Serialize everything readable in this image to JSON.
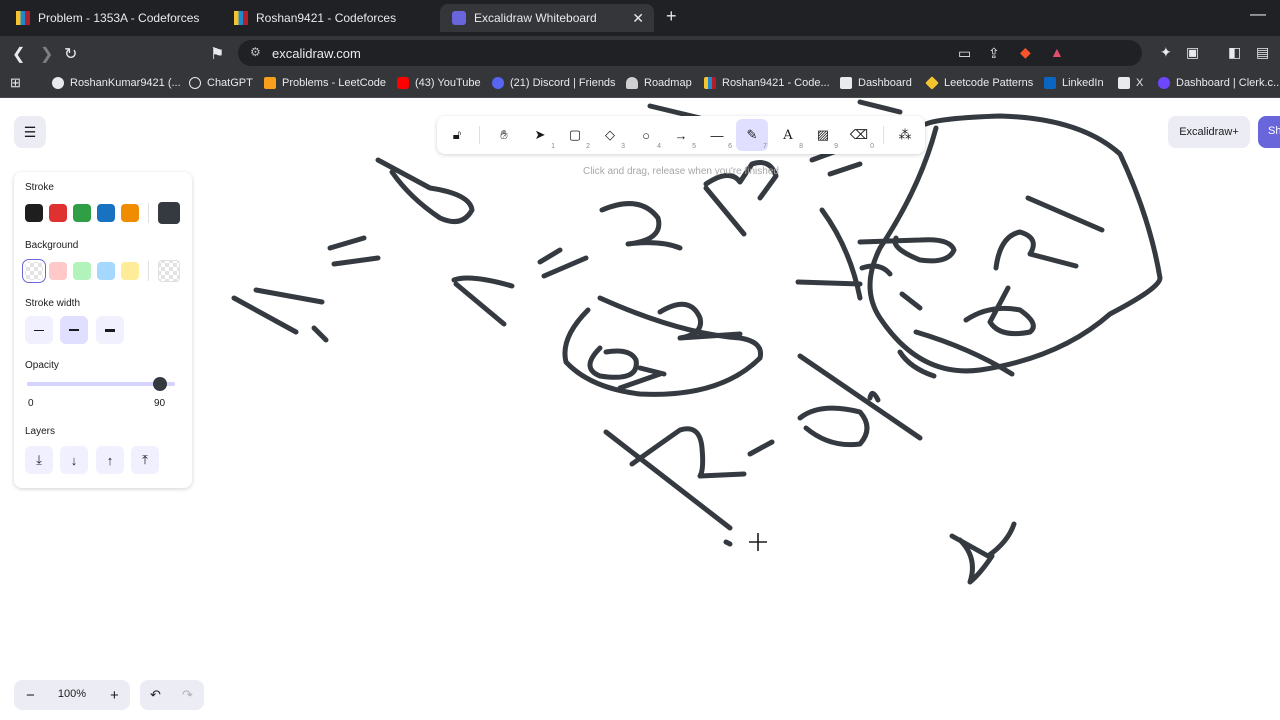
{
  "browser": {
    "tabs": [
      {
        "label": "Problem - 1353A - Codeforces"
      },
      {
        "label": "Roshan9421 - Codeforces"
      },
      {
        "label": "Excalidraw Whiteboard"
      }
    ],
    "url": "excalidraw.com",
    "bookmarks": [
      {
        "label": "RoshanKumar9421 (..."
      },
      {
        "label": "ChatGPT"
      },
      {
        "label": "Problems - LeetCode"
      },
      {
        "label": "(43) YouTube"
      },
      {
        "label": "(21) Discord | Friends"
      },
      {
        "label": "Roadmap"
      },
      {
        "label": "Roshan9421 - Code..."
      },
      {
        "label": "Dashboard"
      },
      {
        "label": "Leetcode Patterns"
      },
      {
        "label": "LinkedIn"
      },
      {
        "label": "X"
      },
      {
        "label": "Dashboard | Clerk.c..."
      }
    ]
  },
  "toolbar": {
    "tools": [
      {
        "name": "lock",
        "num": ""
      },
      {
        "name": "hand",
        "num": ""
      },
      {
        "name": "selection",
        "num": "1"
      },
      {
        "name": "rectangle",
        "num": "2"
      },
      {
        "name": "diamond",
        "num": "3"
      },
      {
        "name": "ellipse",
        "num": "4"
      },
      {
        "name": "arrow",
        "num": "5"
      },
      {
        "name": "line",
        "num": "6"
      },
      {
        "name": "draw",
        "num": "7"
      },
      {
        "name": "text",
        "num": "8"
      },
      {
        "name": "image",
        "num": "9"
      },
      {
        "name": "eraser",
        "num": "0"
      },
      {
        "name": "extra-tools",
        "num": ""
      }
    ],
    "active_tool": "draw",
    "hint": "Click and drag, release when you're finished"
  },
  "top_right": {
    "plus_label": "Excalidraw+",
    "share_label": "Sh"
  },
  "properties": {
    "stroke_label": "Stroke",
    "stroke_colors": [
      "#1e1e1e",
      "#e03131",
      "#2f9e44",
      "#1971c2",
      "#f08c00"
    ],
    "stroke_current": "#343a40",
    "background_label": "Background",
    "background_colors": [
      "transparent",
      "#ffc9c9",
      "#b2f2bb",
      "#a5d8ff",
      "#ffec99"
    ],
    "stroke_width_label": "Stroke width",
    "stroke_width_active": "bold",
    "opacity_label": "Opacity",
    "opacity_min": "0",
    "opacity_max": "90",
    "opacity_value": 0.9,
    "layers_label": "Layers"
  },
  "footer": {
    "zoom": "100%",
    "zoom_out": "−",
    "zoom_in": "+"
  },
  "colors": {
    "accent": "#6965db",
    "accent_light": "#e0dfff",
    "ink": "#343a40",
    "chrome_dark": "#202124",
    "chrome_mid": "#35363a"
  }
}
